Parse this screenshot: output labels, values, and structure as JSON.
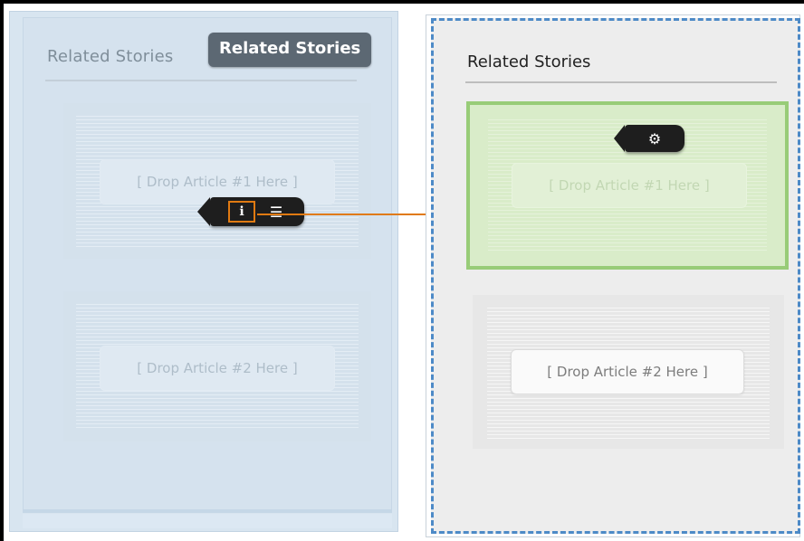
{
  "left_panel": {
    "title": "Related Stories",
    "tooltip": "Related Stories",
    "drop_zones": [
      {
        "label": "[ Drop Article #1 Here ]"
      },
      {
        "label": "[ Drop Article #2 Here ]"
      }
    ],
    "toolbar": {
      "info_icon": "info-icon",
      "list_icon": "list-icon",
      "info_glyph": "ℹ",
      "list_glyph": "☰"
    }
  },
  "right_panel": {
    "title": "Related Stories",
    "drop_zones": [
      {
        "label": "[ Drop Article #1 Here ]",
        "state": "active"
      },
      {
        "label": "[ Drop Article #2 Here ]",
        "state": "normal"
      }
    ],
    "settings": {
      "icon": "gear-icon",
      "glyph": "⚙"
    }
  },
  "colors": {
    "left_panel_bg": "#d8e5f0",
    "accent_orange": "#e07a12",
    "drop_target_green": "#98cc78",
    "dashed_border_blue": "#4d8ac7",
    "toolbar_dark": "#1e1e1e"
  }
}
